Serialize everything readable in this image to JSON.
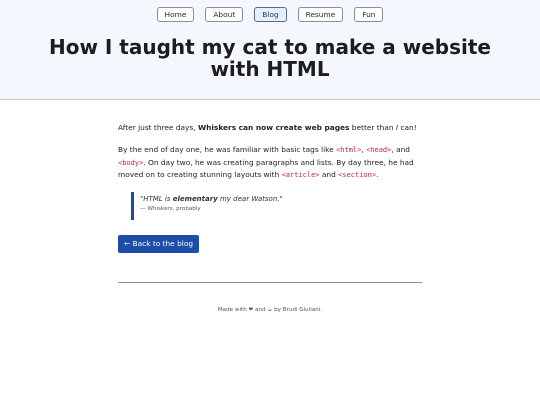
{
  "nav": {
    "items": [
      {
        "label": "Home"
      },
      {
        "label": "About"
      },
      {
        "label": "Blog",
        "active": true
      },
      {
        "label": "Resume"
      },
      {
        "label": "Fun"
      }
    ]
  },
  "header": {
    "title": "How I taught my cat to make a website with HTML"
  },
  "article": {
    "p1": {
      "pre": "After just three days, ",
      "bold": "Whiskers can now create web pages",
      "mid": " better than ",
      "em": "I",
      "post": " can!"
    },
    "p2": {
      "t1": "By the end of day one, he was familiar with basic tags like ",
      "c1": "<html>",
      "t2": ", ",
      "c2": "<head>",
      "t3": ", and ",
      "c3": "<body>",
      "t4": ". On day two, he was creating paragraphs and lists. By day three, he had moved on to creating stunning layouts with ",
      "c4": "<article>",
      "t5": " and ",
      "c5": "<section>",
      "t6": "."
    },
    "quote": {
      "q_open": "\"HTML is ",
      "q_bold": "elementary",
      "q_close": " my dear Watson.\"",
      "cite": "— Whiskers, probably"
    },
    "back_button": "← Back to the blog"
  },
  "footer": {
    "text": "Made with ❤ and ☕ by Brudi Giuliani."
  },
  "colors": {
    "accent": "#1f4ea8",
    "code": "#c0225a",
    "header_bg": "#f5f7fe"
  }
}
